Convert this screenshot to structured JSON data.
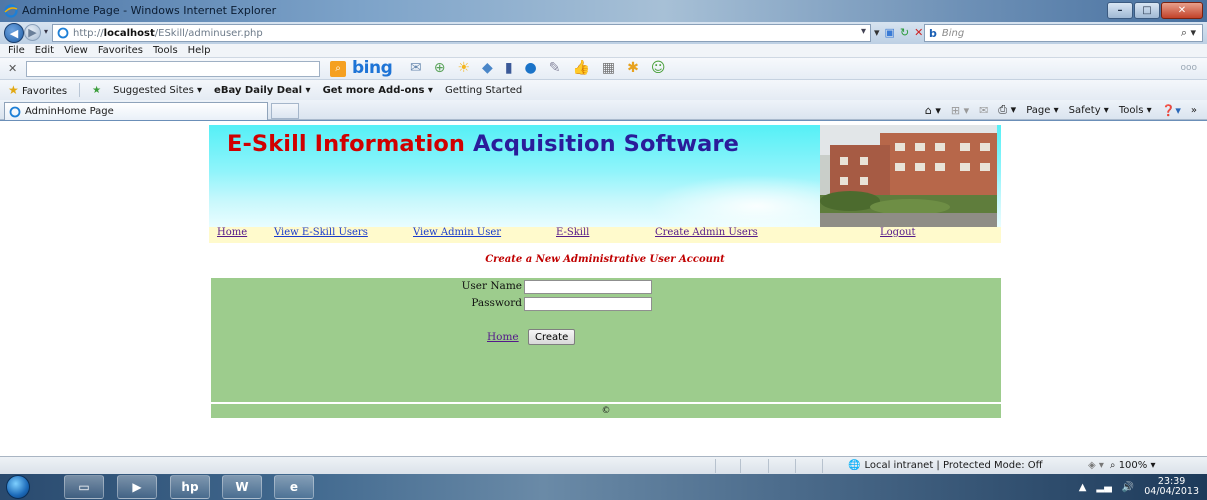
{
  "window": {
    "title": "AdminHome Page - Windows Internet Explorer"
  },
  "address_bar": {
    "url_prefix": "http://",
    "url_host": "localhost",
    "url_path": "/ESkill/adminuser.php",
    "search_placeholder": "Bing",
    "search_engine_label": "b"
  },
  "menu": [
    "File",
    "Edit",
    "View",
    "Favorites",
    "Tools",
    "Help"
  ],
  "bing_toolbar": {
    "logo": "bing",
    "more": "ooo"
  },
  "favorites_bar": {
    "favorites_label": "Favorites",
    "items": [
      {
        "label": "Suggested Sites ▾",
        "bold": false
      },
      {
        "label": "eBay Daily Deal ▾",
        "bold": true
      },
      {
        "label": "Get more Add-ons ▾",
        "bold": true
      },
      {
        "label": "Getting Started",
        "bold": false
      }
    ]
  },
  "tab": {
    "label": "AdminHome Page"
  },
  "command_bar": {
    "page": "Page ▾",
    "safety": "Safety ▾",
    "tools": "Tools ▾"
  },
  "page": {
    "banner_title_red": "E-Skill Information ",
    "banner_title_blue_1": "Acquisition ",
    "banner_title_blue_2": "Software",
    "nav": {
      "home": "Home",
      "view_eskill_users": "View E-Skill Users",
      "view_admin_user": "View Admin User",
      "eskill": "E-Skill",
      "create_admin_users": "Create Admin Users",
      "logout": "Logout"
    },
    "heading": "Create a New Administrative User Account",
    "form": {
      "username_label": "User Name",
      "username_value": "",
      "password_label": "Password",
      "password_value": "",
      "home_link": "Home",
      "create_button": "Create"
    },
    "footer": "©"
  },
  "status_bar": {
    "zone": "Local intranet | Protected Mode: Off",
    "zoom": "100%"
  },
  "taskbar": {
    "time": "23:39",
    "date": "04/04/2013"
  },
  "colors": {
    "form_panel": "#9dcc8d",
    "nav_strip": "#fffacc",
    "heading": "#c00000",
    "banner_red": "#d00000",
    "banner_blue": "#2a1c9a"
  }
}
